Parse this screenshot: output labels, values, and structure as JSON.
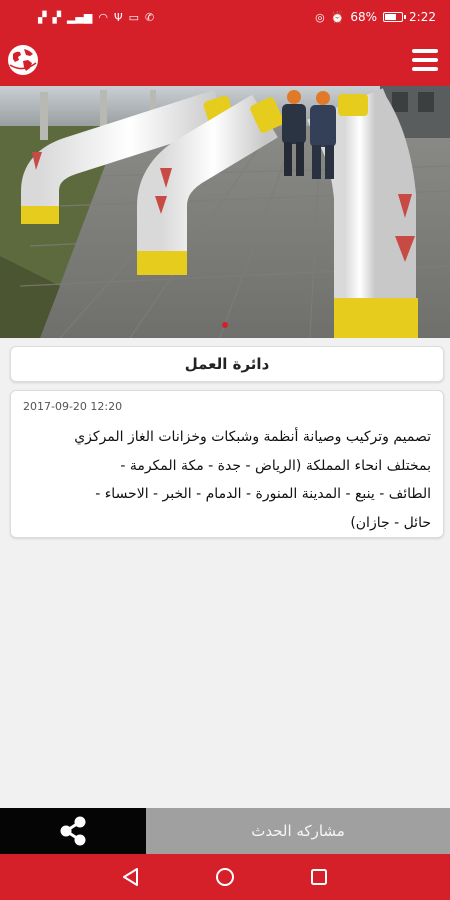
{
  "status_bar": {
    "left_icons": [
      "notification-icon",
      "notification-icon",
      "signal-icon",
      "wifi-off-icon",
      "usb-icon",
      "laptop-icon",
      "phone-icon"
    ],
    "right_icons": [
      "headphones-icon",
      "alarm-icon"
    ],
    "battery_text": "68%",
    "battery_level": 0.68,
    "time": "2:22"
  },
  "app_bar": {
    "logo_icon": "globe-logo-icon",
    "menu_icon": "hamburger-menu-icon"
  },
  "hero": {
    "pager_total": 1,
    "pager_active": 0
  },
  "post": {
    "title": "دائرة العمل",
    "date": "2017-09-20 12:20",
    "body_lines": [
      "تصميم وتركيب وصيانة أنظمة وشبكات وخزانات الغاز المركزي",
      "بمختلف انحاء المملكة (الرياض - جدة - مكة المكرمة -",
      "الطائف - ينبع - المدينة المنورة - الدمام - الخبر - الاحساء -",
      "حائل - جازان)"
    ]
  },
  "actions": {
    "share_icon": "share-icon",
    "share_label": "مشاركه الحدث"
  },
  "nav_bar": {
    "back_icon": "back-triangle-icon",
    "home_icon": "home-circle-icon",
    "recents_icon": "recents-square-icon"
  },
  "colors": {
    "accent": "#d5202a",
    "action_dark": "#050505",
    "action_gray": "#a0a0a0"
  }
}
